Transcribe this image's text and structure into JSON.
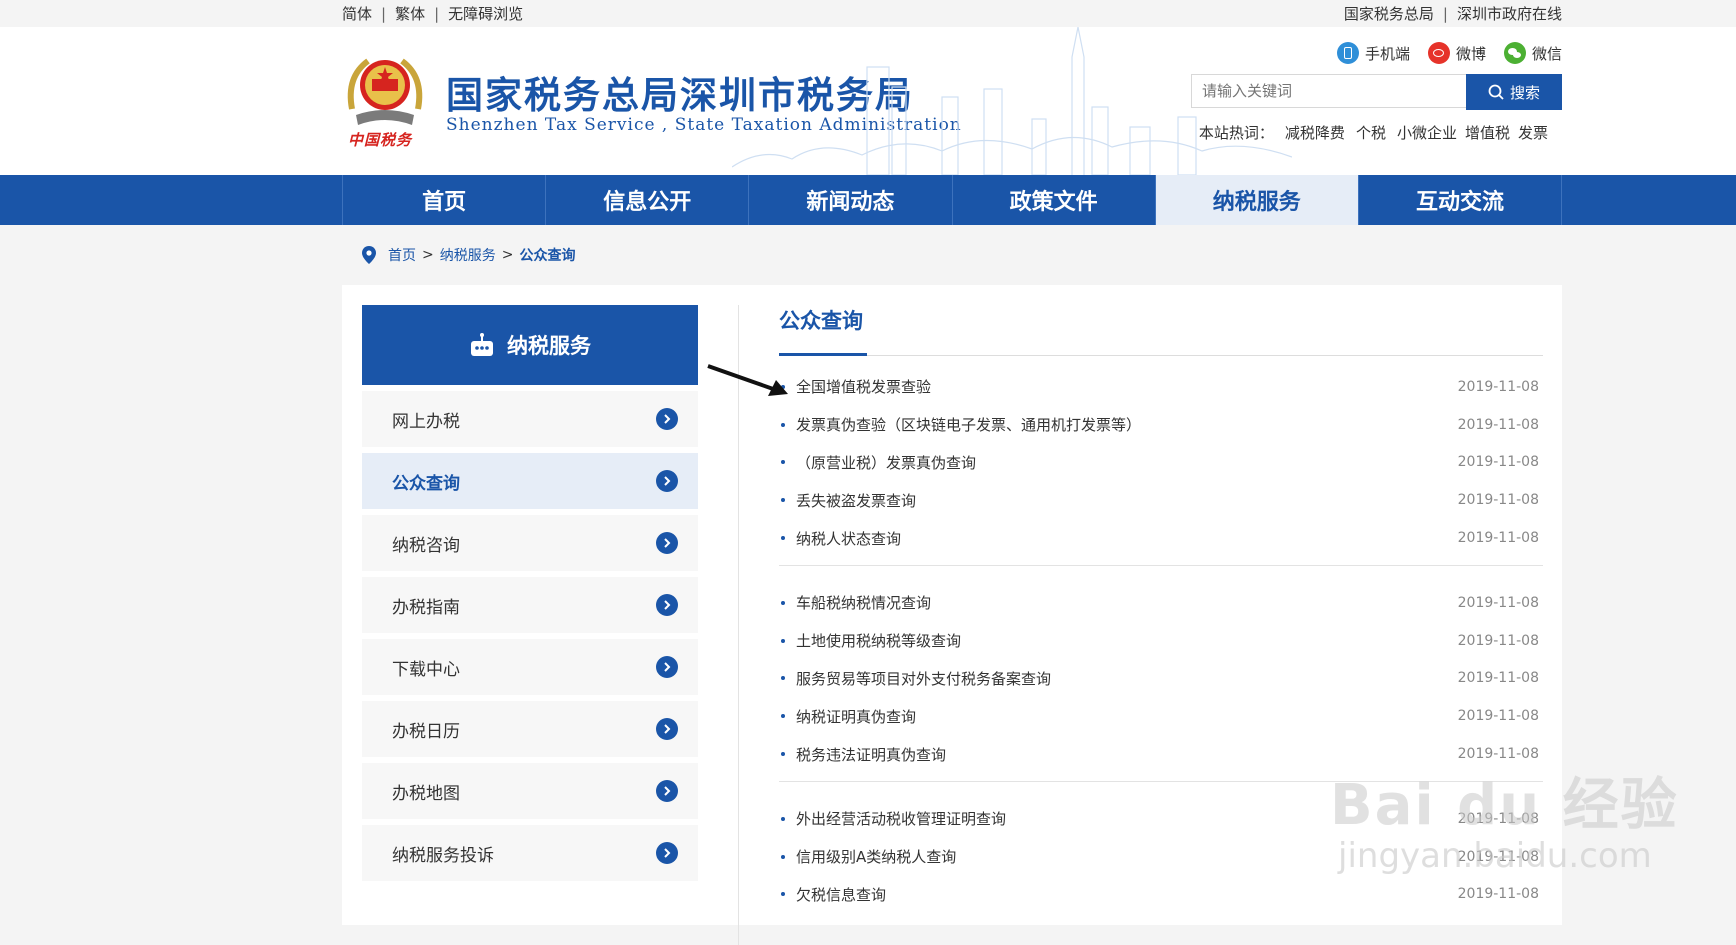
{
  "topbar": {
    "left_links": [
      "简体",
      "繁体",
      "无障碍浏览"
    ],
    "right_links": [
      "国家税务总局",
      "深圳市政府在线"
    ]
  },
  "header": {
    "emblem_text": "中国税务",
    "title": "国家税务总局深圳市税务局",
    "subtitle": "Shenzhen  Tax  Service ,  State  Taxation  Administration",
    "social": [
      {
        "label": "手机端",
        "icon": "mobile-icon",
        "color": "#2f8fd8"
      },
      {
        "label": "微博",
        "icon": "weibo-icon",
        "color": "#e6332a"
      },
      {
        "label": "微信",
        "icon": "wechat-icon",
        "color": "#4cb033"
      }
    ],
    "search_placeholder": "请输入关键词",
    "search_button": "搜索",
    "hot_label": "本站热词：",
    "hot_words": [
      "减税降费",
      "个税",
      "小微企业",
      "增值税",
      "发票"
    ]
  },
  "nav": {
    "items": [
      "首页",
      "信息公开",
      "新闻动态",
      "政策文件",
      "纳税服务",
      "互动交流"
    ],
    "active_index": 4
  },
  "breadcrumb": {
    "items": [
      "首页",
      "纳税服务",
      "公众查询"
    ],
    "separator": ">"
  },
  "sidebar": {
    "title": "纳税服务",
    "items": [
      "网上办税",
      "公众查询",
      "纳税咨询",
      "办税指南",
      "下载中心",
      "办税日历",
      "办税地图",
      "纳税服务投诉"
    ],
    "active_index": 1
  },
  "content": {
    "title": "公众查询",
    "groups": [
      [
        {
          "title": "全国增值税发票查验",
          "date": "2019-11-08"
        },
        {
          "title": "发票真伪查验（区块链电子发票、通用机打发票等）",
          "date": "2019-11-08"
        },
        {
          "title": "（原营业税）发票真伪查询",
          "date": "2019-11-08"
        },
        {
          "title": "丢失被盗发票查询",
          "date": "2019-11-08"
        },
        {
          "title": "纳税人状态查询",
          "date": "2019-11-08"
        }
      ],
      [
        {
          "title": "车船税纳税情况查询",
          "date": "2019-11-08"
        },
        {
          "title": "土地使用税纳税等级查询",
          "date": "2019-11-08"
        },
        {
          "title": "服务贸易等项目对外支付税务备案查询",
          "date": "2019-11-08"
        },
        {
          "title": "纳税证明真伪查询",
          "date": "2019-11-08"
        },
        {
          "title": "税务违法证明真伪查询",
          "date": "2019-11-08"
        }
      ],
      [
        {
          "title": "外出经营活动税收管理证明查询",
          "date": "2019-11-08"
        },
        {
          "title": "信用级别A类纳税人查询",
          "date": "2019-11-08"
        },
        {
          "title": "欠税信息查询",
          "date": "2019-11-08"
        }
      ]
    ]
  },
  "watermark": {
    "line1": "Bai du 经验",
    "line2": "jingyan.baidu.com"
  },
  "colors": {
    "brand": "#1a55a8",
    "nav_active_bg": "#e6edf7"
  }
}
